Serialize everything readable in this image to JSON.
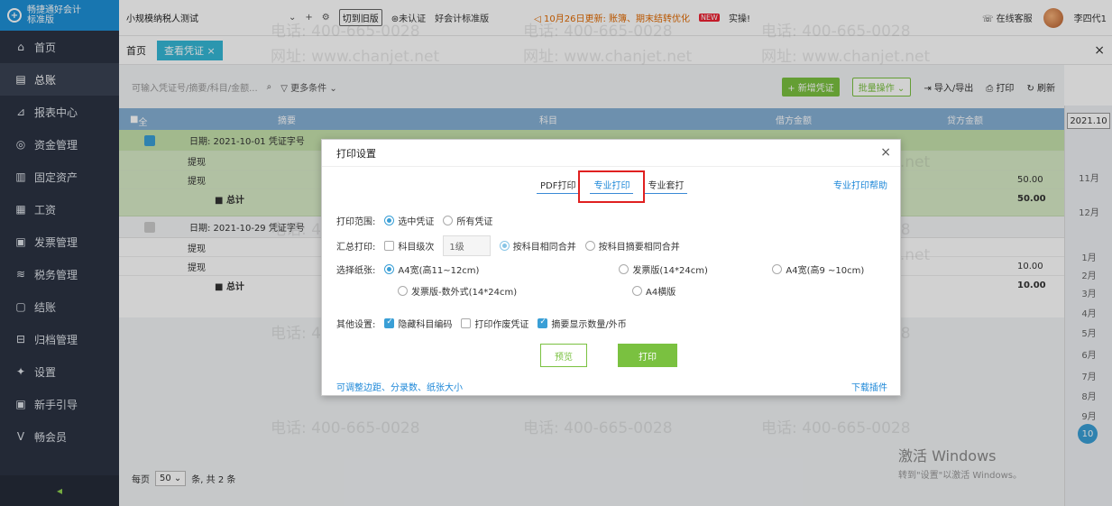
{
  "sidebar": {
    "logo_line1": "畅捷通好会计",
    "logo_line2": "标准版",
    "items": [
      {
        "label": "首页",
        "icon": "⌂"
      },
      {
        "label": "总账",
        "icon": "▤"
      },
      {
        "label": "报表中心",
        "icon": "⊿"
      },
      {
        "label": "资金管理",
        "icon": "◎"
      },
      {
        "label": "固定资产",
        "icon": "▥"
      },
      {
        "label": "工资",
        "icon": "▦"
      },
      {
        "label": "发票管理",
        "icon": "▣"
      },
      {
        "label": "税务管理",
        "icon": "≋"
      },
      {
        "label": "结账",
        "icon": "▢"
      },
      {
        "label": "归档管理",
        "icon": "⊟"
      },
      {
        "label": "设置",
        "icon": "✦"
      },
      {
        "label": "新手引导",
        "icon": "▣"
      },
      {
        "label": "畅会员",
        "icon": "V"
      }
    ],
    "collapse_icon": "◂"
  },
  "topbar": {
    "company": "小规模纳税人测试",
    "switch_label": "切到旧版",
    "cert_label": "⊛未认证",
    "book_label": "好会计标准版",
    "notice": "10月26日更新: 账簿、期末结转优化",
    "notice_new": "实操!",
    "service_label": "在线客服",
    "user_name": "李四代1"
  },
  "tabs": {
    "home": "首页",
    "active": "查看凭证",
    "close": "×"
  },
  "filter": {
    "placeholder": "可输入凭证号/摘要/科目/金额...",
    "more": "更多条件",
    "new_voucher": "+ 新增凭证",
    "batch": "批量操作",
    "import_export": "导入/导出",
    "print": "打印",
    "refresh": "刷新"
  },
  "table": {
    "headers": {
      "select_all": "全选",
      "summary": "摘要",
      "subject": "科目",
      "debit": "借方金额",
      "credit": "贷方金额"
    },
    "groups": [
      {
        "header": "日期: 2021-10-01   凭证字号",
        "lines": [
          {
            "summary": "提现",
            "credit": ""
          },
          {
            "summary": "提现",
            "credit": "50.00"
          }
        ],
        "total_label": "总计",
        "total": "50.00"
      },
      {
        "header": "日期: 2021-10-29   凭证字号",
        "lines": [
          {
            "summary": "提现",
            "credit": ""
          },
          {
            "summary": "提现",
            "credit": "10.00"
          }
        ],
        "total_label": "总计",
        "total": "10.00"
      }
    ]
  },
  "footer": {
    "per_page_label": "每页",
    "per_page": "50",
    "count": "条, 共 2 条"
  },
  "period": {
    "year": "2021.10",
    "months": [
      "11月",
      "12月",
      "1月",
      "2月",
      "3月",
      "4月",
      "5月",
      "6月",
      "7月",
      "8月",
      "9月"
    ],
    "active": "10"
  },
  "watermark": {
    "phone": "电话: 400-665-0028",
    "site": "网址: www.chanjet.net"
  },
  "windows": {
    "line1": "激活 Windows",
    "line2": "转到\"设置\"以激活 Windows。"
  },
  "dialog": {
    "title": "打印设置",
    "close": "×",
    "modes": [
      "PDF打印",
      "专业打印",
      "专业套打"
    ],
    "help": "专业打印帮助",
    "range_label": "打印范围:",
    "range_selected": "选中凭证",
    "range_all": "所有凭证",
    "summary_label": "汇总打印:",
    "subject_level": "科目级次",
    "level_value": "1级",
    "merge_subject": "按科目相同合并",
    "merge_summary": "按科目摘要相同合并",
    "paper_label": "选择纸张:",
    "paper_a4": "A4宽(高11~12cm)",
    "paper_invoice": "发票版(14*24cm)",
    "paper_a4_small": "A4宽(高9 ~10cm)",
    "paper_invoice_out": "发票版-数外式(14*24cm)",
    "paper_a4_landscape": "A4横版",
    "other_label": "其他设置:",
    "hide_code": "隐藏科目编码",
    "print_void": "打印作废凭证",
    "show_qty": "摘要显示数量/外币",
    "preview": "预览",
    "print": "打印",
    "adjust_link": "可调整边距、分录数、纸张大小",
    "download_link": "下载插件"
  }
}
